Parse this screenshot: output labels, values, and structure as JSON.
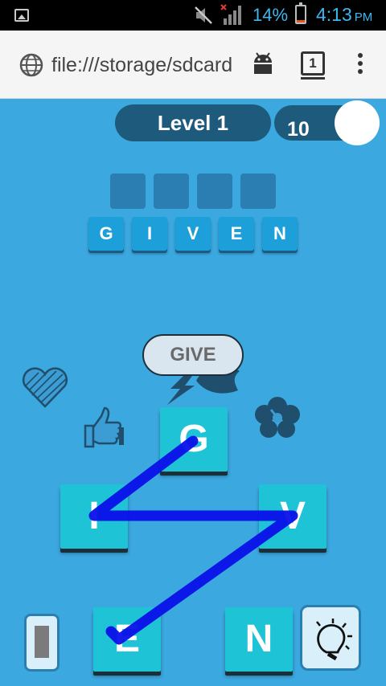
{
  "status_bar": {
    "battery": "14%",
    "battery_level": 0.14,
    "time": "4:13",
    "ampm": "PM",
    "icons": [
      "gallery-icon",
      "mute-icon",
      "signal-icon",
      "battery-icon"
    ]
  },
  "browser": {
    "url": "file:///storage/sdcard",
    "tab_count": "1",
    "icons": [
      "globe-icon",
      "android-icon",
      "overflow-menu-icon"
    ]
  },
  "game": {
    "level_label": "Level 1",
    "coins": "10",
    "answer_slots": 4,
    "bonus_word": [
      "G",
      "I",
      "V",
      "E",
      "N"
    ],
    "current_word": "GIVE",
    "wheel_letters": [
      "G",
      "I",
      "V",
      "E",
      "N"
    ],
    "decorations": [
      "heart-icon",
      "thumbs-up-icon",
      "lightning-icon",
      "leaf-icon",
      "hibiscus-icon"
    ],
    "buttons": [
      "shuffle-button",
      "hint-bulb-button"
    ],
    "colors": {
      "background": "#3ba8e0",
      "tile": "#1ec3d6",
      "pill": "#1e5a7c",
      "swipe_line": "#0a10e8"
    }
  }
}
